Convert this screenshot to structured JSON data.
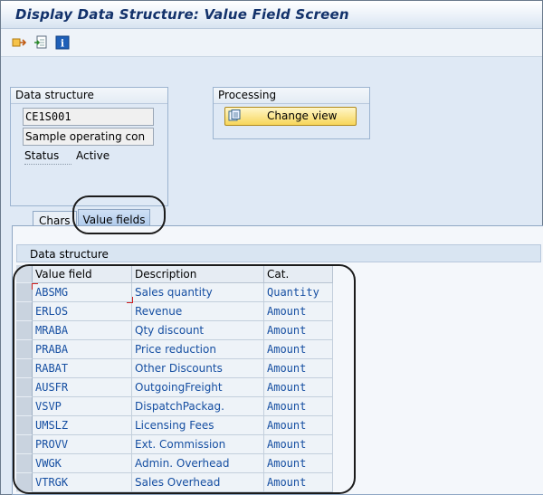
{
  "window": {
    "title": "Display Data Structure: Value Field Screen"
  },
  "toolbar": {
    "icons": [
      "other-object-icon",
      "check-icon",
      "info-icon"
    ]
  },
  "data_structure_group": {
    "title": "Data structure",
    "name": "CE1S001",
    "description": "Sample operating con",
    "status_label": "Status",
    "status_value": "Active"
  },
  "processing_group": {
    "title": "Processing",
    "button_label": "Change view"
  },
  "tabs": [
    {
      "label": "Chars",
      "active": false
    },
    {
      "label": "Value fields",
      "active": true
    }
  ],
  "tab_content": {
    "subheader": "Data structure"
  },
  "table": {
    "columns": [
      "Value field",
      "Description",
      "Cat."
    ],
    "rows": [
      {
        "field": "ABSMG",
        "description": "Sales quantity",
        "category": "Quantity"
      },
      {
        "field": "ERLOS",
        "description": "Revenue",
        "category": "Amount"
      },
      {
        "field": "MRABA",
        "description": "Qty discount",
        "category": "Amount"
      },
      {
        "field": "PRABA",
        "description": "Price reduction",
        "category": "Amount"
      },
      {
        "field": "RABAT",
        "description": "Other Discounts",
        "category": "Amount"
      },
      {
        "field": "AUSFR",
        "description": "OutgoingFreight",
        "category": "Amount"
      },
      {
        "field": "VSVP",
        "description": "DispatchPackag.",
        "category": "Amount"
      },
      {
        "field": "UMSLZ",
        "description": "Licensing Fees",
        "category": "Amount"
      },
      {
        "field": "PROVV",
        "description": "Ext. Commission",
        "category": "Amount"
      },
      {
        "field": "VWGK",
        "description": "Admin. Overhead",
        "category": "Amount"
      },
      {
        "field": "VTRGK",
        "description": "Sales Overhead",
        "category": "Amount"
      }
    ]
  },
  "colors": {
    "title": "#13326b",
    "field_text": "#164fa2",
    "button": "#f7d65a"
  }
}
